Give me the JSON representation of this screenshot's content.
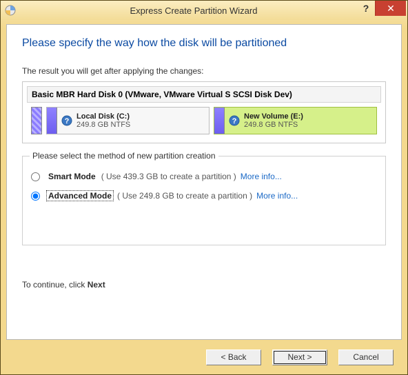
{
  "window": {
    "title": "Express Create Partition Wizard",
    "help": "?",
    "close": "✕"
  },
  "heading": "Please specify the way how the disk will be partitioned",
  "result_label": "The result you will get after applying the changes:",
  "disk": {
    "header": "Basic MBR Hard Disk 0 (VMware, VMware Virtual S SCSI Disk Dev)",
    "vol_c": {
      "name": "Local Disk (C:)",
      "size": "249.8 GB NTFS"
    },
    "vol_e": {
      "name": "New Volume (E:)",
      "size": "249.8 GB NTFS"
    }
  },
  "group_title": "Please select the method of new partition creation",
  "modes": {
    "smart": {
      "name": "Smart Mode",
      "desc": "( Use 439.3 GB to create a partition )",
      "more": "More info..."
    },
    "advanced": {
      "name": "Advanced Mode",
      "desc": "( Use 249.8 GB to create a partition )",
      "more": "More info..."
    }
  },
  "continue_prefix": "To continue, click ",
  "continue_bold": "Next",
  "buttons": {
    "back": "< Back",
    "next": "Next >",
    "cancel": "Cancel"
  }
}
